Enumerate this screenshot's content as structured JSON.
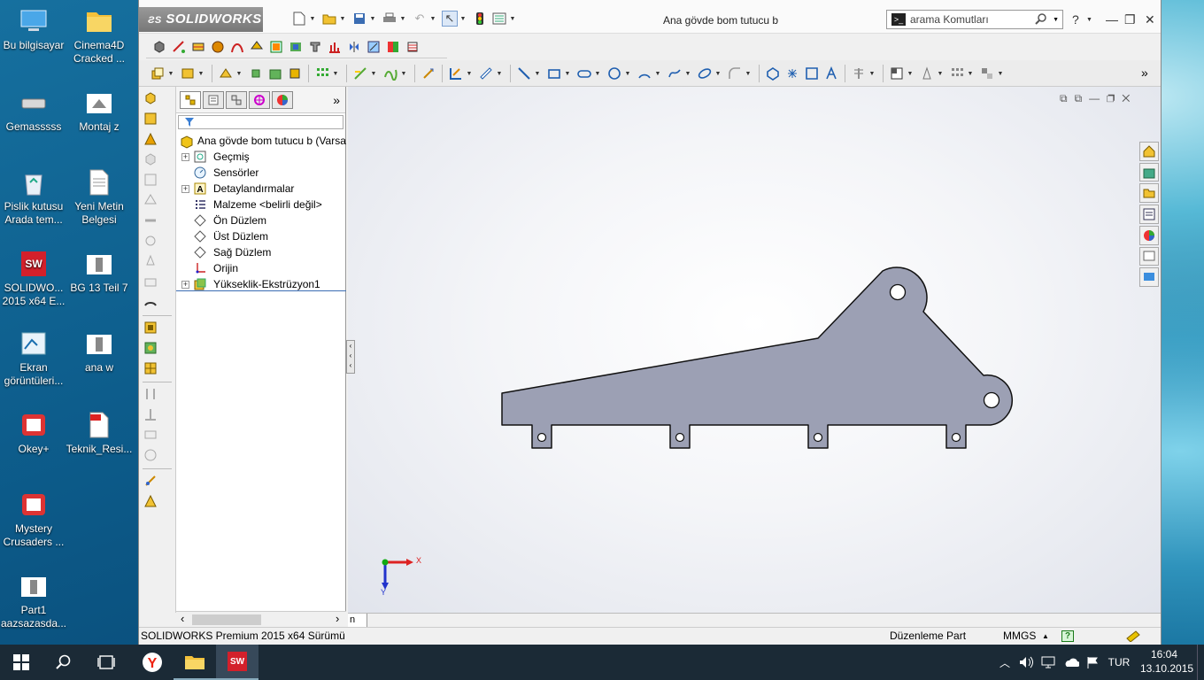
{
  "desktop": {
    "icons": [
      {
        "label": "Bu bilgisayar",
        "icon": "computer-icon"
      },
      {
        "label": "Cinema4D Cracked ...",
        "icon": "folder-icon"
      },
      {
        "label": "Gemasssss",
        "icon": "drive-icon"
      },
      {
        "label": "Montaj z",
        "icon": "assembly-icon"
      },
      {
        "label": "Pislik kutusu Arada tem...",
        "icon": "recycle-bin-icon"
      },
      {
        "label": "Yeni Metin Belgesi",
        "icon": "text-file-icon"
      },
      {
        "label": "SOLIDWO... 2015 x64 E...",
        "icon": "solidworks-icon"
      },
      {
        "label": "BG 13 Teil 7",
        "icon": "part-icon"
      },
      {
        "label": "Ekran görüntüleri...",
        "icon": "screenshot-folder-icon"
      },
      {
        "label": "ana w",
        "icon": "part-icon"
      },
      {
        "label": "Okey+",
        "icon": "game-icon"
      },
      {
        "label": "Teknik_Resi...",
        "icon": "pdf-icon"
      },
      {
        "label": "Mystery Crusaders ...",
        "icon": "game-icon"
      },
      {
        "label": "Part1 aazsazasda...",
        "icon": "part-icon"
      }
    ]
  },
  "app": {
    "brand": "SOLIDWORKS",
    "document_title": "Ana gövde bom tutucu b",
    "search_placeholder": "arama Komutları",
    "help_icon": "?",
    "window_controls": {
      "minimize": "—",
      "restore": "❐",
      "close": "✕"
    }
  },
  "feature_tree": {
    "root": "Ana gövde bom tutucu b  (Varsa",
    "items": [
      {
        "label": "Geçmiş",
        "expandable": true,
        "icon": "history-icon"
      },
      {
        "label": "Sensörler",
        "expandable": false,
        "icon": "sensor-icon"
      },
      {
        "label": "Detaylandırmalar",
        "expandable": true,
        "icon": "annotations-icon"
      },
      {
        "label": "Malzeme <belirli değil>",
        "expandable": false,
        "icon": "material-icon"
      },
      {
        "label": "Ön Düzlem",
        "expandable": false,
        "icon": "plane-icon"
      },
      {
        "label": "Üst Düzlem",
        "expandable": false,
        "icon": "plane-icon"
      },
      {
        "label": "Sağ Düzlem",
        "expandable": false,
        "icon": "plane-icon"
      },
      {
        "label": "Orijin",
        "expandable": false,
        "icon": "origin-icon"
      },
      {
        "label": "Yükseklik-Ekstrüzyon1",
        "expandable": true,
        "icon": "extrude-icon"
      }
    ],
    "expand_glyph": "+",
    "collapse_arrow": "»",
    "scroll_left": "‹",
    "scroll_right": "›"
  },
  "graphics": {
    "triad_x": "X",
    "triad_y": "Y",
    "model_tab": "n",
    "part_color": "#9ca0b4",
    "background_color": "#f2f3f6"
  },
  "status_bar": {
    "left": "SOLIDWORKS Premium 2015 x64 Sürümü",
    "mode": "Düzenleme Part",
    "units": "MMGS",
    "units_caret": "▲"
  },
  "taskbar": {
    "language": "TUR",
    "time": "16:04",
    "date": "13.10.2015"
  }
}
